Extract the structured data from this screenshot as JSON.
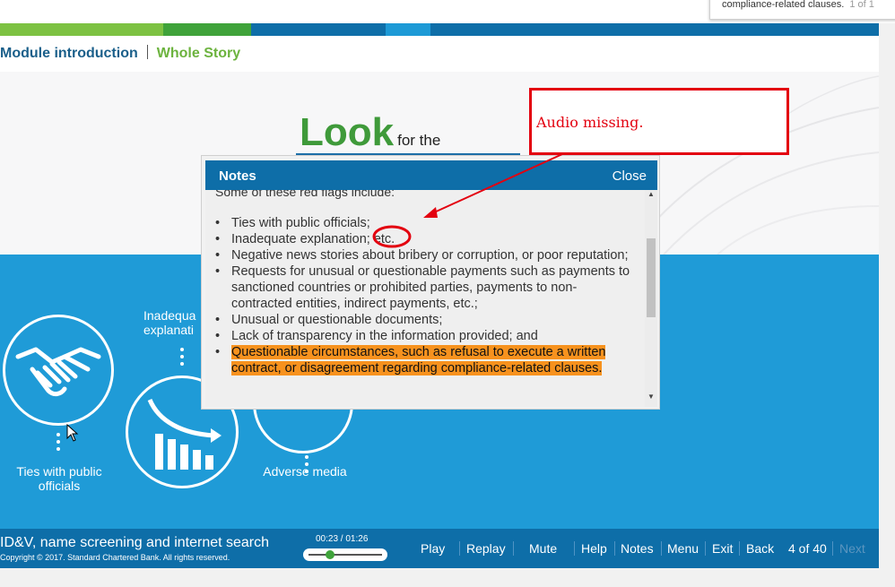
{
  "browser": {
    "search_popup_text": "compliance-related clauses.",
    "search_popup_count": "1 of 1"
  },
  "course": {
    "strip_colors": [
      "#7dc242",
      "#3fa33a",
      "#0e6ea8",
      "#1d9ad6",
      "#0e6ea8"
    ],
    "breadcrumb": {
      "section": "Module introduction",
      "current": "Whole Story"
    },
    "heading": {
      "big": "Look",
      "small": "for the"
    },
    "accent_green": "#3f9a3a",
    "panel_blue": "#1f9bd7",
    "icons": [
      {
        "name": "handshake-icon",
        "label": "Ties with public officials"
      },
      {
        "name": "declining-chart-icon",
        "label": "Inadequate explanation"
      },
      {
        "name": "newspaper-icon",
        "label": "Adverse media"
      }
    ],
    "partial_label": "Inadequa explanati"
  },
  "notes": {
    "title": "Notes",
    "close_label": "Close",
    "intro": "Some of these red flags include:",
    "items": [
      "Ties with public officials;",
      "Inadequate explanation; etc.",
      "Negative news stories about bribery or corruption, or poor reputation;",
      "Requests for unusual or questionable payments such as payments to sanctioned countries or prohibited parties, payments to non-contracted entities, indirect payments, etc.;",
      "Unusual or questionable documents;",
      "Lack of transparency in the information provided; and",
      "Questionable circumstances, such as refusal to execute a written contract, or disagreement regarding compliance-related clauses."
    ],
    "highlight_color": "#f7921e"
  },
  "annotation": {
    "text": "Audio missing.",
    "color": "#e3000f"
  },
  "player": {
    "course_title": "ID&V, name screening and internet search",
    "copyright": "Copyright © 2017. Standard Chartered Bank. All rights reserved.",
    "time": "00:23 / 01:26",
    "progress": 0.27,
    "controls": {
      "play": "Play",
      "replay": "Replay",
      "mute": "Mute",
      "help": "Help",
      "notes": "Notes",
      "menu": "Menu",
      "exit": "Exit",
      "back": "Back",
      "page": "4 of 40",
      "next": "Next"
    }
  }
}
